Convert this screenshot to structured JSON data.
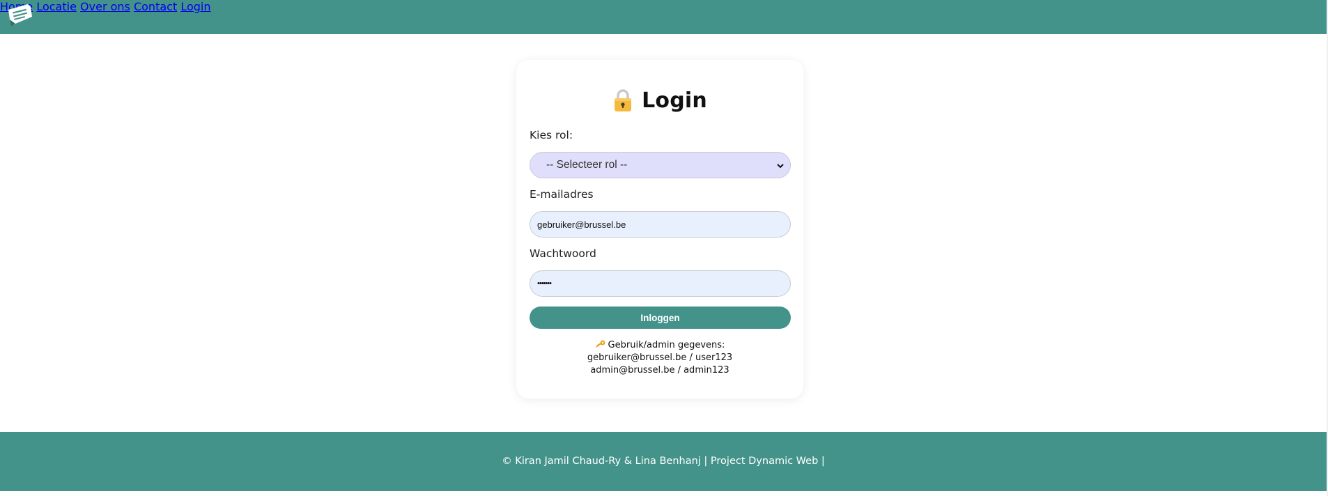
{
  "header": {
    "logo_icon": "site-logo",
    "nav": [
      {
        "label": "Home"
      },
      {
        "label": "Locatie"
      },
      {
        "label": "Over ons"
      },
      {
        "label": "Contact"
      },
      {
        "label": "Login"
      }
    ]
  },
  "login": {
    "title": "Login",
    "title_icon": "lock-icon",
    "role_label": "Kies rol:",
    "role_selected": "-- Selecteer rol --",
    "email_label": "E-mailadres",
    "email_value": "gebruiker@brussel.be",
    "password_label": "Wachtwoord",
    "password_value": "•••••••",
    "submit_label": "Inloggen",
    "info_icon": "key-icon",
    "info_heading": "Gebruik/admin gegevens:",
    "info_line_1": "gebruiker@brussel.be / user123",
    "info_line_2": "admin@brussel.be / admin123"
  },
  "footer": {
    "text": "© Kiran Jamil Chaud-Ry & Lina Benhanj | Project Dynamic Web |"
  },
  "colors": {
    "brand": "#43938a",
    "select_bg": "#dfdffb",
    "input_bg": "#e8f0fe"
  }
}
